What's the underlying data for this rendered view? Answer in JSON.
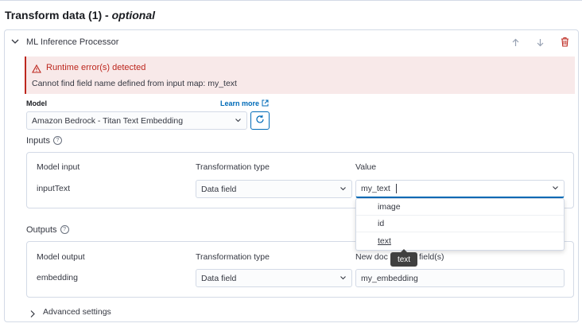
{
  "page": {
    "title": "Transform data (1) -",
    "title_optional": "optional"
  },
  "processor": {
    "title": "ML Inference Processor",
    "icons": [
      "chevron-down-icon",
      "arrow-up-icon",
      "arrow-down-icon",
      "trash-icon"
    ]
  },
  "callout": {
    "title": "Runtime error(s) detected",
    "message": "Cannot find field name defined from input map: my_text"
  },
  "model": {
    "label": "Model",
    "learn_more": "Learn more",
    "selected": "Amazon Bedrock - Titan Text Embedding"
  },
  "inputs": {
    "label": "Inputs",
    "headers": [
      "Model input",
      "Transformation type",
      "Value"
    ],
    "row": {
      "model_input": "inputText",
      "transformation": "Data field",
      "value": "my_text"
    }
  },
  "dropdown": {
    "options": [
      "image",
      "id",
      "text"
    ]
  },
  "tooltip": {
    "text": "text"
  },
  "outputs": {
    "label": "Outputs",
    "headers": [
      "Model output",
      "Transformation type",
      "New document field(s)"
    ],
    "header_visible_parts": {
      "left": "New doc",
      "right": "field(s)"
    },
    "row": {
      "model_output": "embedding",
      "transformation": "Data field",
      "value": "my_embedding"
    }
  },
  "advanced": {
    "label": "Advanced settings"
  },
  "colors": {
    "danger": "#bd271e",
    "link": "#006bb8",
    "callout_bg": "#f8e9e9",
    "border": "#d3dae6"
  }
}
